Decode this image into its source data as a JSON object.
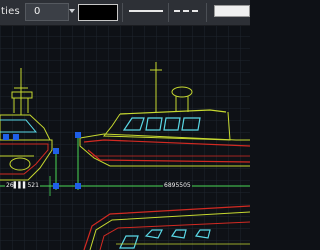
{
  "toolbar": {
    "properties_label": "ties",
    "lineweight_value": "0",
    "color_value": "#000000",
    "linetype_solid": "solid",
    "linetype_dashed": "dashed",
    "linetype_box": "box"
  },
  "drawing": {
    "dimension_left": "26▌▌▌521",
    "dimension_right": "6895505",
    "colors": {
      "hull_outline": "#c7d930",
      "hull_inner": "#d22a22",
      "window": "#5ad8e6",
      "grip": "#1f5fe8",
      "dimension_line": "#49d957"
    }
  }
}
